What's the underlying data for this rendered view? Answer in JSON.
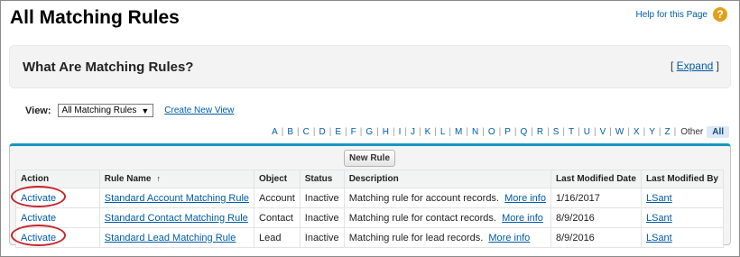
{
  "page": {
    "title": "All Matching Rules",
    "help_link": "Help for this Page",
    "help_icon": "question-icon"
  },
  "info": {
    "title": "What Are Matching Rules?",
    "expand_open": "[ ",
    "expand_label": "Expand",
    "expand_close": " ]"
  },
  "view": {
    "label": "View:",
    "selected": "All Matching Rules",
    "create_link": "Create New View"
  },
  "alphabet": {
    "letters": [
      "A",
      "B",
      "C",
      "D",
      "E",
      "F",
      "G",
      "H",
      "I",
      "J",
      "K",
      "L",
      "M",
      "N",
      "O",
      "P",
      "Q",
      "R",
      "S",
      "T",
      "U",
      "V",
      "W",
      "X",
      "Y",
      "Z"
    ],
    "other": "Other",
    "all": "All"
  },
  "list": {
    "new_rule_button": "New Rule",
    "columns": [
      "Action",
      "Rule Name",
      "Object",
      "Status",
      "Description",
      "Last Modified Date",
      "Last Modified By"
    ],
    "sort_indicator": "↑",
    "rows": [
      {
        "action": "Activate",
        "rule_name": "Standard Account Matching Rule",
        "object": "Account",
        "status": "Inactive",
        "description": "Matching rule for account records.",
        "more": "More info",
        "date": "1/16/2017",
        "by": "LSant"
      },
      {
        "action": "Activate",
        "rule_name": "Standard Contact Matching Rule",
        "object": "Contact",
        "status": "Inactive",
        "description": "Matching rule for contact records.",
        "more": "More info",
        "date": "8/9/2016",
        "by": "LSant"
      },
      {
        "action": "Activate",
        "rule_name": "Standard Lead Matching Rule",
        "object": "Lead",
        "status": "Inactive",
        "description": "Matching rule for lead records.",
        "more": "More info",
        "date": "8/9/2016",
        "by": "LSant"
      }
    ]
  },
  "colors": {
    "link": "#015ba7",
    "panel_accent": "#1797c0",
    "highlight_circle": "#c4262e",
    "help_icon_bg": "#e2a01a"
  }
}
